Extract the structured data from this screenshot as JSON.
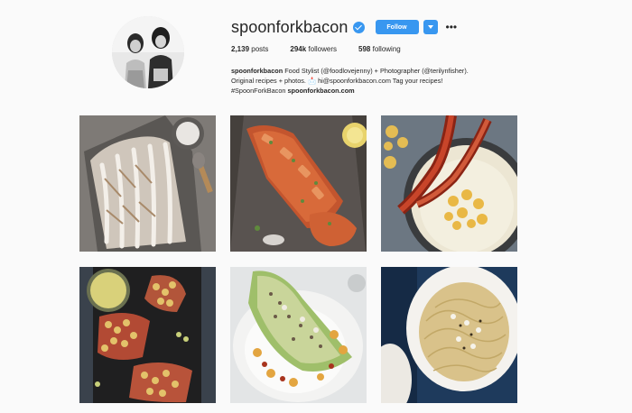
{
  "profile": {
    "username": "spoonforkbacon",
    "verified": true,
    "follow_label": "Follow",
    "more_label": "•••",
    "stats": {
      "posts": "2,139",
      "posts_label": "posts",
      "followers": "294k",
      "followers_label": "followers",
      "following": "598",
      "following_label": "following"
    },
    "bio": {
      "name": "spoonforkbacon",
      "line1": "Food Stylist (@foodlovejenny) + Photographer (@terilynfisher).",
      "line2": "Original recipes + photos. 📩 hi@spoonforkbacon.com Tag your recipes!",
      "hashtag": "#SpoonForkBacon",
      "handle": "spoonforkbacon.com"
    }
  },
  "colors": {
    "accent": "#3897f0",
    "background": "#fafafa",
    "text": "#262626"
  },
  "icons": {
    "verified": "verified-badge-icon",
    "dropdown": "chevron-down-icon",
    "more": "more-options-icon"
  },
  "posts": [
    {
      "subject": "powdered sugar pastry braid"
    },
    {
      "subject": "saucy bbq bread"
    },
    {
      "subject": "bacon with creamy polenta"
    },
    {
      "subject": "roasted chickpea toasts"
    },
    {
      "subject": "wedge salad"
    },
    {
      "subject": "spaghetti with parmesan"
    }
  ]
}
